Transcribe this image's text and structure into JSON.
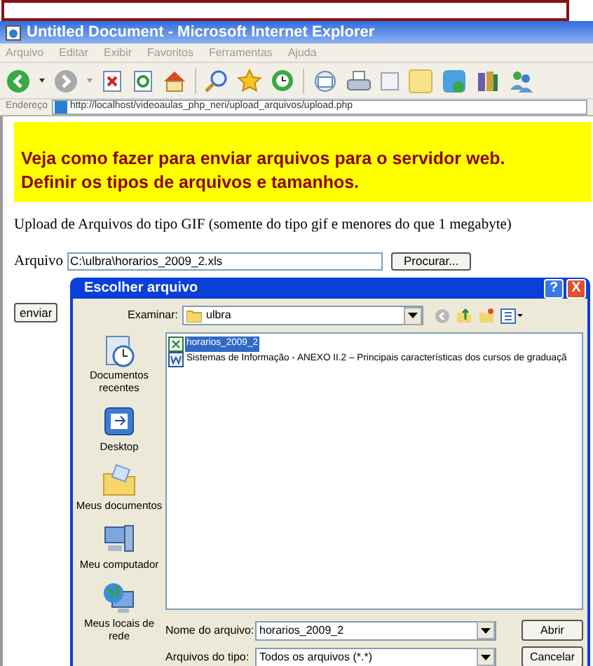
{
  "window": {
    "title": "Untitled Document - Microsoft Internet Explorer"
  },
  "menu": [
    "Arquivo",
    "Editar",
    "Exibir",
    "Favoritos",
    "Ferramentas",
    "Ajuda"
  ],
  "address": {
    "label": "Endereço",
    "value": "http://localhost/videoaulas_php_neri/upload_arquivos/upload.php"
  },
  "banner": [
    "Veja como fazer para enviar arquivos para o servidor web.",
    "Definir os tipos de arquivos e tamanhos."
  ],
  "description": "Upload de Arquivos do tipo GIF (somente do tipo gif e menores do que 1 megabyte)",
  "file_field": {
    "label": "Arquivo",
    "value": "C:\\ulbra\\horarios_2009_2.xls",
    "browse_button": "Procurar..."
  },
  "submit_button": "enviar",
  "dialog": {
    "title": "Escolher arquivo",
    "help": "?",
    "close": "X",
    "look_in": {
      "label": "Examinar:",
      "value": "ulbra"
    },
    "places": [
      {
        "kind": "recent",
        "label": "Documentos recentes"
      },
      {
        "kind": "desktop",
        "label": "Desktop"
      },
      {
        "kind": "documents",
        "label": "Meus documentos"
      },
      {
        "kind": "computer",
        "label": "Meu computador"
      },
      {
        "kind": "network",
        "label": "Meus locais de rede"
      }
    ],
    "files": [
      {
        "name": "horarios_2009_2",
        "selected": true,
        "kind": "excel"
      },
      {
        "name": "Sistemas de Informação - ANEXO II.2 – Principais características dos cursos de graduaçã",
        "selected": false,
        "kind": "word"
      }
    ],
    "file_name": {
      "label": "Nome do arquivo:",
      "value": "horarios_2009_2"
    },
    "file_type": {
      "label": "Arquivos do tipo:",
      "value": "Todos os arquivos (*.*)"
    },
    "buttons": [
      "Abrir",
      "Cancelar"
    ]
  }
}
